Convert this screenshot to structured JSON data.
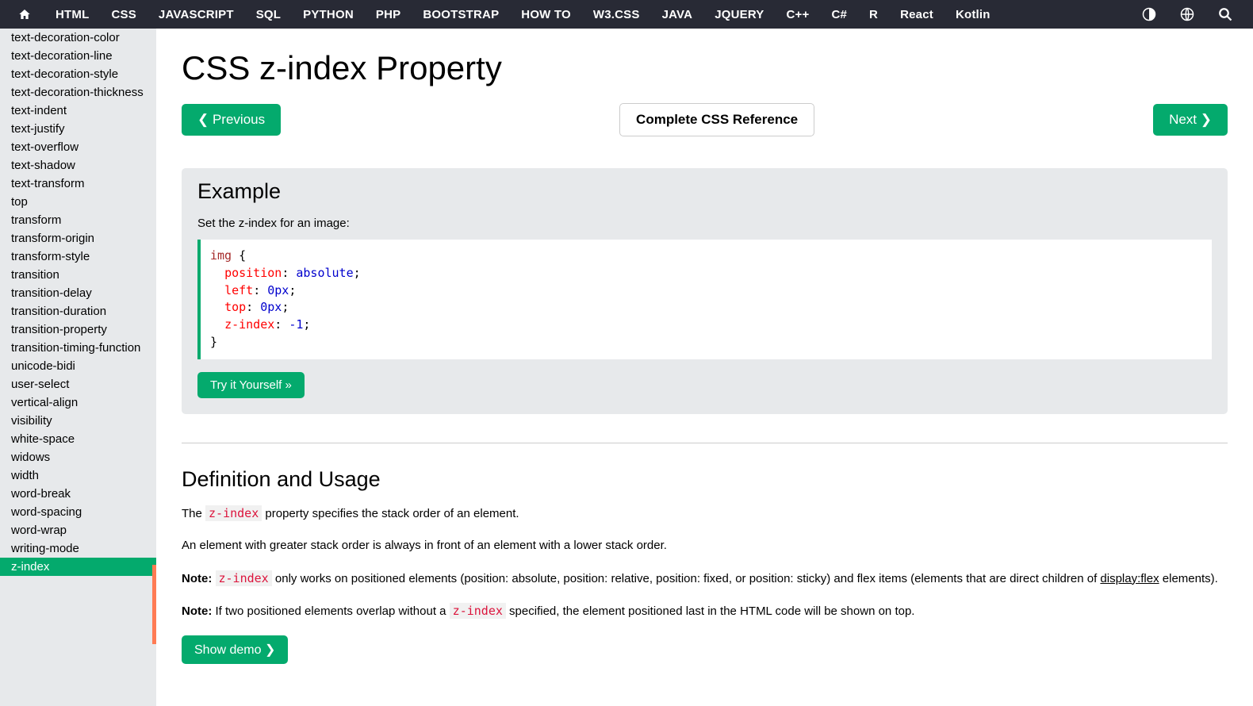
{
  "topnav": {
    "items": [
      "HTML",
      "CSS",
      "JAVASCRIPT",
      "SQL",
      "PYTHON",
      "PHP",
      "BOOTSTRAP",
      "HOW TO",
      "W3.CSS",
      "JAVA",
      "JQUERY",
      "C++",
      "C#",
      "R",
      "React",
      "Kotlin"
    ]
  },
  "sidebar": {
    "items": [
      "text-decoration-color",
      "text-decoration-line",
      "text-decoration-style",
      "text-decoration-thickness",
      "text-indent",
      "text-justify",
      "text-overflow",
      "text-shadow",
      "text-transform",
      "top",
      "transform",
      "transform-origin",
      "transform-style",
      "transition",
      "transition-delay",
      "transition-duration",
      "transition-property",
      "transition-timing-function",
      "unicode-bidi",
      "user-select",
      "vertical-align",
      "visibility",
      "white-space",
      "widows",
      "width",
      "word-break",
      "word-spacing",
      "word-wrap",
      "writing-mode",
      "z-index"
    ],
    "active": "z-index"
  },
  "page": {
    "title": "CSS z-index Property",
    "prev": "❮ Previous",
    "next": "Next ❯",
    "complete": "Complete CSS Reference"
  },
  "example": {
    "heading": "Example",
    "desc": "Set the z-index for an image:",
    "try": "Try it Yourself »",
    "code": {
      "selector": "img",
      "open": " {",
      "lines": [
        {
          "prop": "position",
          "val": "absolute"
        },
        {
          "prop": "left",
          "val": "0px"
        },
        {
          "prop": "top",
          "val": "0px"
        },
        {
          "prop": "z-index",
          "val": "-1"
        }
      ],
      "close": "}"
    }
  },
  "definition": {
    "heading": "Definition and Usage",
    "p1_a": "The ",
    "p1_code": "z-index",
    "p1_b": " property specifies the stack order of an element.",
    "p2": "An element with greater stack order is always in front of an element with a lower stack order.",
    "note_label": "Note:",
    "p3_a": " ",
    "p3_code": "z-index",
    "p3_b": " only works on positioned elements (position: absolute, position: relative, position: fixed, or position: sticky) and flex items (elements that are direct children of ",
    "p3_link": "display:flex",
    "p3_c": " elements).",
    "p4_a": " If two positioned elements overlap without a ",
    "p4_code": "z-index",
    "p4_b": " specified, the element positioned last in the HTML code will be shown on top.",
    "show_demo": "Show demo ❯"
  }
}
